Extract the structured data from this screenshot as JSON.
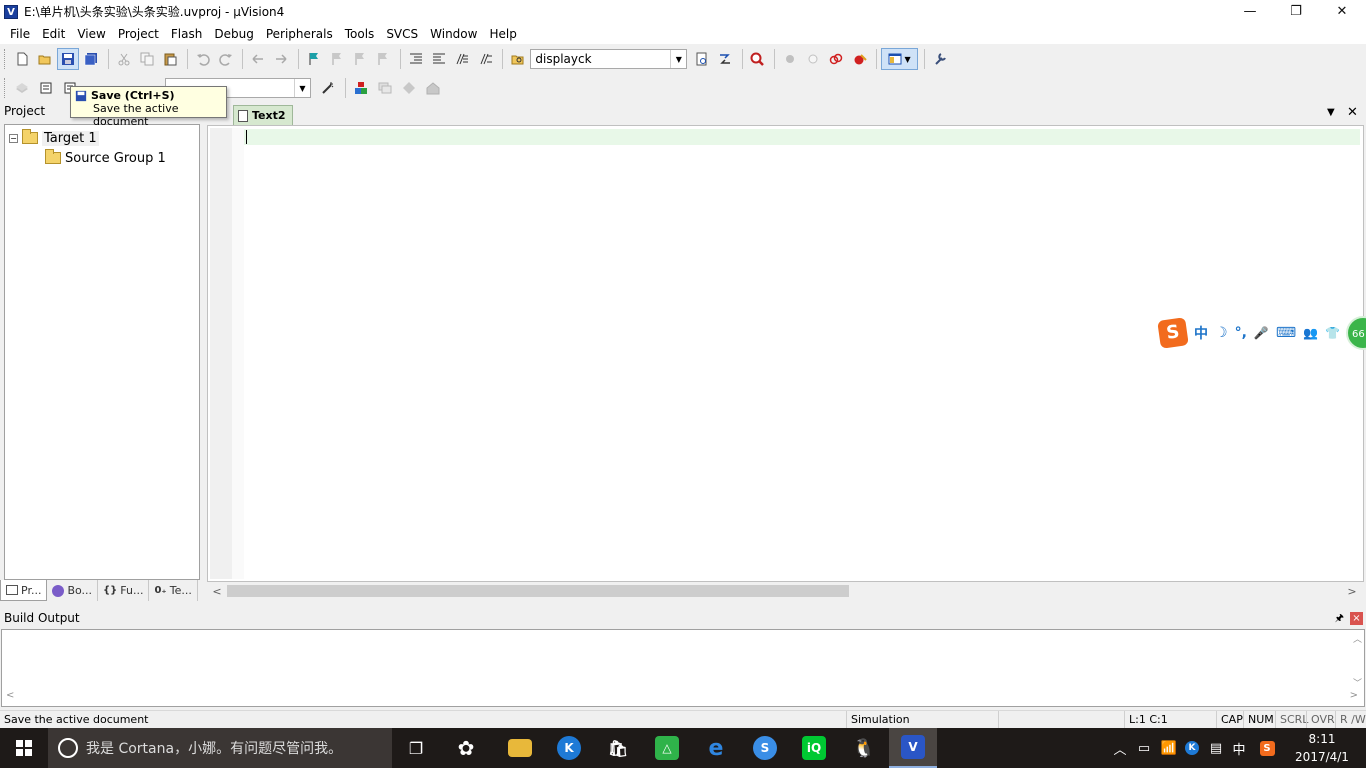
{
  "window": {
    "title": "E:\\单片机\\头条实验\\头条实验.uvproj - µVision4",
    "icon_label": "V",
    "controls": [
      "minimize-icon",
      "restore-icon",
      "close-icon"
    ],
    "controls_glyphs": [
      "—",
      "❐",
      "✕"
    ]
  },
  "menu": [
    "File",
    "Edit",
    "View",
    "Project",
    "Flash",
    "Debug",
    "Peripherals",
    "Tools",
    "SVCS",
    "Window",
    "Help"
  ],
  "toolbar1": {
    "target_combo_value": "displayck"
  },
  "toolbar2": {
    "target_select_value": ""
  },
  "tooltip": {
    "title": "Save (Ctrl+S)",
    "description": "Save the active document"
  },
  "project_panel": {
    "header": "Project",
    "tree": [
      {
        "label": "Target 1",
        "expander": "−"
      },
      {
        "label": "Source Group 1"
      }
    ],
    "tabs": [
      {
        "label": "Pr...",
        "icon": "project-tab-icon"
      },
      {
        "label": "Bo...",
        "icon": "books-tab-icon"
      },
      {
        "label": "Fu...",
        "icon": "functions-tab-icon"
      },
      {
        "label": "Te...",
        "icon": "templates-tab-icon"
      }
    ]
  },
  "editor": {
    "tab_label": "Text2",
    "dropdown_glyph": "▼",
    "close_glyph": "✕"
  },
  "build_output": {
    "header": "Build Output",
    "pin_glyph": "📌",
    "close_glyph": "×"
  },
  "statusbar": {
    "message": "Save the active document",
    "mode": "Simulation",
    "position": "L:1 C:1",
    "indicators": [
      "CAP",
      "NUM",
      "SCRL",
      "OVR",
      "R /W"
    ]
  },
  "ime": {
    "logo": "S",
    "buttons": [
      "中",
      "☽",
      "°,",
      "🎤",
      "⌨",
      "👥",
      "👕"
    ],
    "badge": "66"
  },
  "taskbar": {
    "cortana_placeholder": "我是 Cortana，小娜。有问题尽管问我。",
    "tray_lang": "中",
    "time": "8:11",
    "date": "2017/4/1",
    "apps": [
      {
        "name": "task-view",
        "glyph": "❐",
        "color": "#1e1a18"
      },
      {
        "name": "pinwheel-app",
        "glyph": "✿",
        "color": "#1e1a18"
      },
      {
        "name": "file-explorer",
        "glyph": "",
        "color": "#e8b83a"
      },
      {
        "name": "kugou",
        "glyph": "K",
        "color": "#1e7ad6"
      },
      {
        "name": "store",
        "glyph": "🛍",
        "color": "#1e1a18"
      },
      {
        "name": "green-app",
        "glyph": "△",
        "color": "#2fb34a"
      },
      {
        "name": "edge",
        "glyph": "e",
        "color": "#1e1a18"
      },
      {
        "name": "sogou-browser",
        "glyph": "S",
        "color": "#3a8ee6"
      },
      {
        "name": "iqiyi",
        "glyph": "iQ",
        "color": "#00c832"
      },
      {
        "name": "qq",
        "glyph": "🐧",
        "color": "#1e1a18"
      },
      {
        "name": "uvision",
        "glyph": "V",
        "color": "#2a56c6"
      }
    ]
  }
}
